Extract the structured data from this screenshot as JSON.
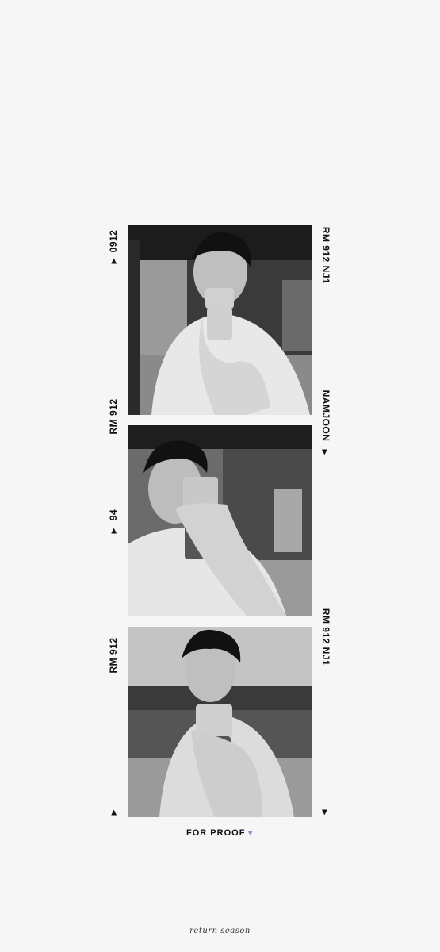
{
  "photos": [
    {
      "alt": "Black and white mirror selfie 1"
    },
    {
      "alt": "Black and white mirror selfie 2"
    },
    {
      "alt": "Black and white mirror selfie 3"
    }
  ],
  "film_labels": {
    "left_top": "0912",
    "left_mid1": "RM 912",
    "left_mid2": "94",
    "left_mid3": "RM 912",
    "right_top": "RM 912  NJ1",
    "right_mid": "NAMJOON",
    "right_bottom": "RM 912  NJ1",
    "marker": "▶"
  },
  "caption": {
    "text": "FOR  PROOF",
    "heart": "♥",
    "heart_color": "#a88ed8"
  },
  "signature": "return season"
}
